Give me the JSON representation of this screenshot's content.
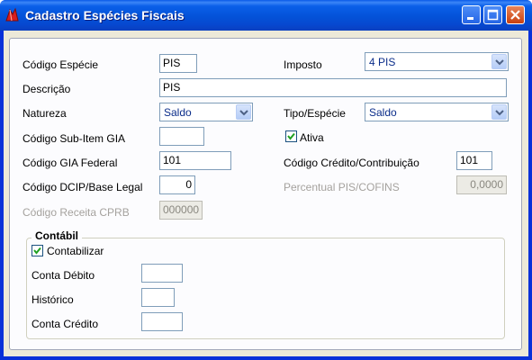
{
  "window": {
    "title": "Cadastro Espécies Fiscais",
    "icons": {
      "app": "red-app-icon",
      "minimize": "minimize-icon",
      "maximize": "maximize-icon",
      "close": "close-icon"
    }
  },
  "form": {
    "codigo_especie": {
      "label": "Código Espécie",
      "value": "PIS"
    },
    "imposto": {
      "label": "Imposto",
      "value": "4 PIS"
    },
    "descricao": {
      "label": "Descrição",
      "value": "PIS"
    },
    "natureza": {
      "label": "Natureza",
      "value": "Saldo"
    },
    "tipo_especie": {
      "label": "Tipo/Espécie",
      "value": "Saldo"
    },
    "codigo_subitem_gia": {
      "label": "Código Sub-Item GIA",
      "value": ""
    },
    "ativa": {
      "label": "Ativa",
      "checked": true
    },
    "codigo_gia_federal": {
      "label": "Código GIA Federal",
      "value": "101"
    },
    "codigo_credito": {
      "label": "Código Crédito/Contribuição",
      "value": "101"
    },
    "codigo_dcip": {
      "label": "Código DCIP/Base Legal",
      "value": "0"
    },
    "percentual_pis": {
      "label": "Percentual PIS/COFINS",
      "value": "0,0000"
    },
    "codigo_receita_cprb": {
      "label": "Código Receita CPRB",
      "value": "000000"
    }
  },
  "contabil": {
    "title": "Contábil",
    "contabilizar": {
      "label": "Contabilizar",
      "checked": true
    },
    "conta_debito": {
      "label": "Conta Débito",
      "value": ""
    },
    "historico": {
      "label": "Histórico",
      "value": ""
    },
    "conta_credito": {
      "label": "Conta Crédito",
      "value": ""
    }
  },
  "colors": {
    "titlebar": "#0a5fe9",
    "window_bg": "#ece9d8",
    "input_border": "#7f9db9",
    "disabled_text": "#a5a29e"
  }
}
